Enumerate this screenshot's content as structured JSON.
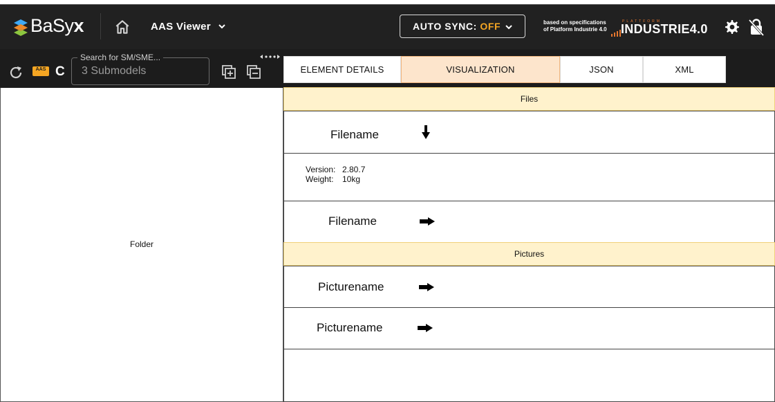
{
  "app": {
    "brand_first": "BaSy",
    "brand_last": "x",
    "viewer_title": "AAS Viewer",
    "auto_sync_label": "AUTO SYNC:",
    "auto_sync_value": "OFF",
    "spec_line1": "based on specifications",
    "spec_line2": "of Platform Industrie 4.0",
    "i40_small": "PLATTFORM",
    "i40_main": "INDUSTRIE4.0",
    "accent_color": "#f5a623"
  },
  "toolbar": {
    "aas_badge": "AAS",
    "aas_letter": "C",
    "search_legend": "Search for SM/SME...",
    "search_value": "3 Submodels"
  },
  "tabs": [
    {
      "label": "ELEMENT DETAILS",
      "active": false
    },
    {
      "label": "VISUALIZATION",
      "active": true
    },
    {
      "label": "JSON",
      "active": false
    },
    {
      "label": "XML",
      "active": false
    }
  ],
  "left_panel": {
    "folder_label": "Folder"
  },
  "visualization": {
    "files_header": "Files",
    "pictures_header": "Pictures",
    "file_rows": [
      {
        "name": "Filename",
        "icon": "arrow-down-icon"
      },
      {
        "version_label": "Version:",
        "version_value": "2.80.7",
        "weight_label": "Weight:",
        "weight_value": "10kg"
      },
      {
        "name": "Filename",
        "icon": "arrow-right-icon"
      }
    ],
    "picture_rows": [
      {
        "name": "Picturename",
        "icon": "arrow-right-icon"
      },
      {
        "name": "Picturename",
        "icon": "arrow-right-icon"
      }
    ]
  }
}
